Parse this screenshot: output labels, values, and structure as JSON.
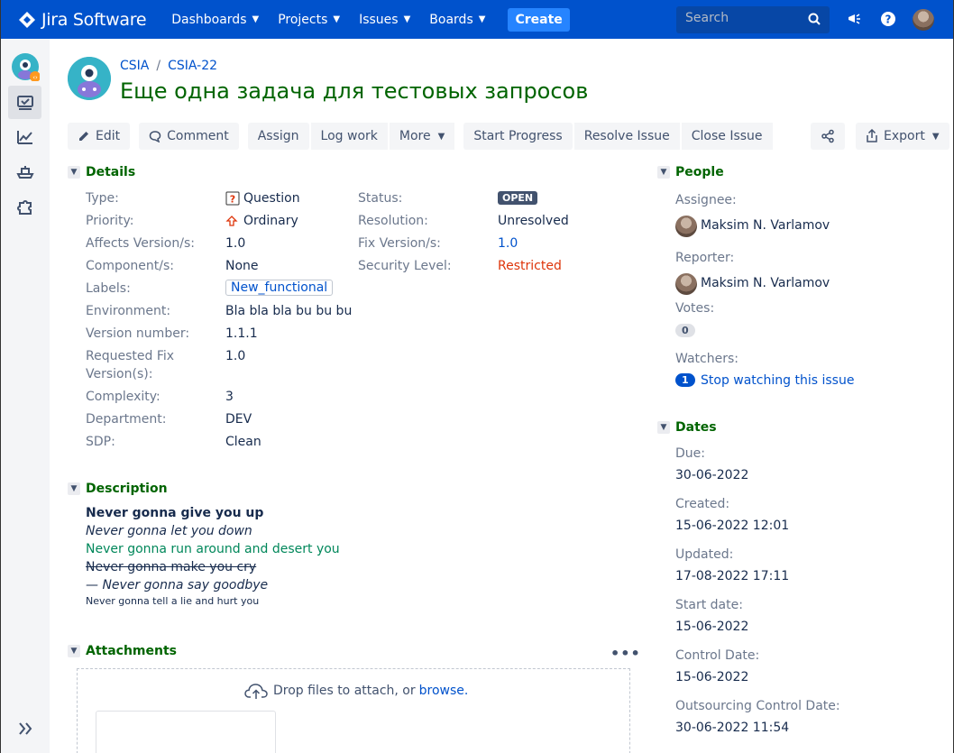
{
  "topbar": {
    "product": "Jira Software",
    "nav": [
      {
        "label": "Dashboards"
      },
      {
        "label": "Projects"
      },
      {
        "label": "Issues"
      },
      {
        "label": "Boards"
      }
    ],
    "create_label": "Create",
    "search_placeholder": "Search"
  },
  "breadcrumb": {
    "project": "CSIA",
    "issue_key": "CSIA-22"
  },
  "issue_title": "Еще одна задача для тестовых запросов",
  "toolbar": {
    "edit": "Edit",
    "comment": "Comment",
    "assign": "Assign",
    "log_work": "Log work",
    "more": "More",
    "start_progress": "Start Progress",
    "resolve_issue": "Resolve Issue",
    "close_issue": "Close Issue",
    "export": "Export"
  },
  "details": {
    "heading": "Details",
    "type_label": "Type:",
    "type_value": "Question",
    "priority_label": "Priority:",
    "priority_value": "Ordinary",
    "affects_label": "Affects Version/s:",
    "affects_value": "1.0",
    "component_label": "Component/s:",
    "component_value": "None",
    "labels_label": "Labels:",
    "labels_value": "New_functional",
    "environment_label": "Environment:",
    "environment_value": "Bla bla bla bu bu bu",
    "version_number_label": "Version number:",
    "version_number_value": "1.1.1",
    "requested_fix_label_1": "Requested Fix",
    "requested_fix_label_2": "Version(s):",
    "requested_fix_value": "1.0",
    "complexity_label": "Complexity:",
    "complexity_value": "3",
    "department_label": "Department:",
    "department_value": "DEV",
    "sdp_label": "SDP:",
    "sdp_value": "Clean",
    "status_label": "Status:",
    "status_value": "OPEN",
    "resolution_label": "Resolution:",
    "resolution_value": "Unresolved",
    "fix_label": "Fix Version/s:",
    "fix_value": "1.0",
    "security_label": "Security Level:",
    "security_value": "Restricted"
  },
  "description": {
    "heading": "Description",
    "lines": [
      "Never gonna give you up",
      "Never gonna let you down",
      "Never gonna run around and desert you",
      "Never gonna make you cry",
      "— Never gonna say goodbye",
      "Never gonna tell a lie and hurt you"
    ]
  },
  "attachments": {
    "heading": "Attachments",
    "drop_text": "Drop files to attach, or",
    "browse_link": "browse."
  },
  "people": {
    "heading": "People",
    "assignee_label": "Assignee:",
    "assignee": "Maksim N. Varlamov",
    "reporter_label": "Reporter:",
    "reporter": "Maksim N. Varlamov",
    "votes_label": "Votes:",
    "votes": "0",
    "watchers_label": "Watchers:",
    "watchers_count": "1",
    "watch_link": "Stop watching this issue"
  },
  "dates": {
    "heading": "Dates",
    "due_label": "Due:",
    "due": "30-06-2022",
    "created_label": "Created:",
    "created": "15-06-2022 12:01",
    "updated_label": "Updated:",
    "updated": "17-08-2022 17:11",
    "start_label": "Start date:",
    "start": "15-06-2022",
    "control_label": "Control Date:",
    "control": "15-06-2022",
    "outsourcing_label": "Outsourcing Control Date:",
    "outsourcing": "30-06-2022 11:54"
  },
  "colors": {
    "topbar": "#0052cc",
    "create": "#2684ff",
    "title_green": "#006400",
    "restricted_red": "#de350b",
    "link_blue": "#0052cc"
  }
}
